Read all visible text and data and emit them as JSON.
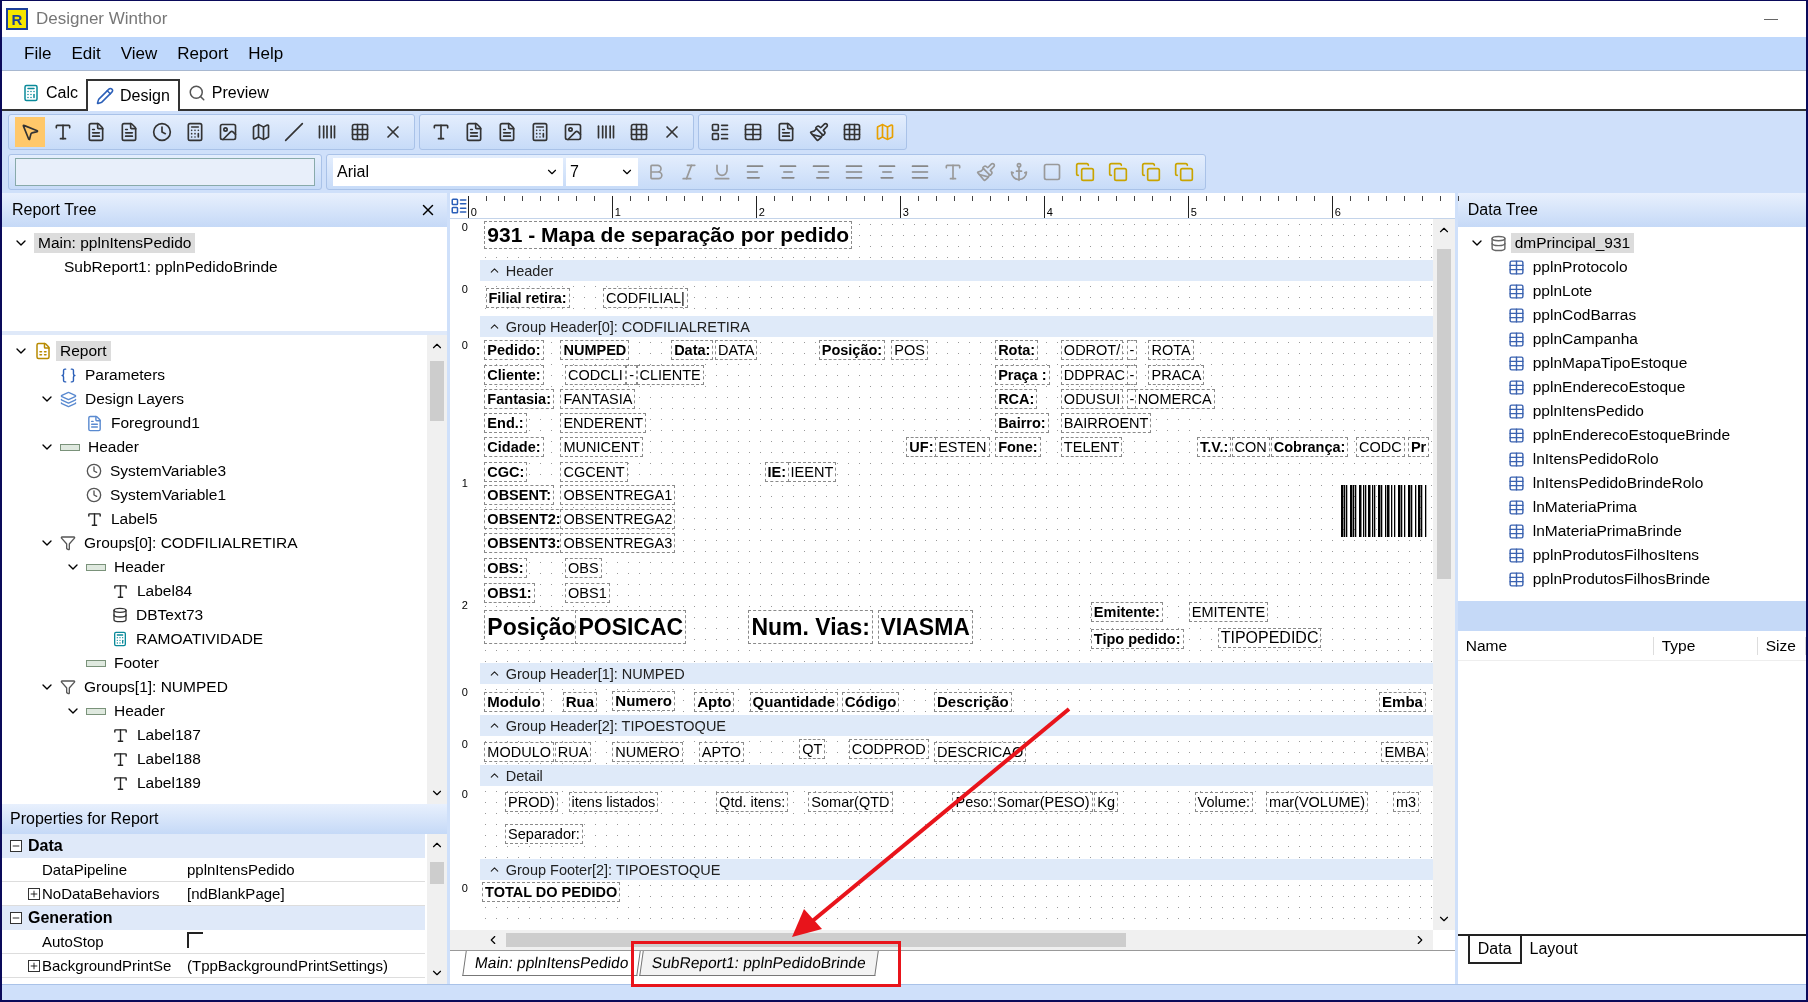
{
  "window": {
    "app_icon": "R",
    "title": "Designer Winthor"
  },
  "menu": [
    "File",
    "Edit",
    "View",
    "Report",
    "Help"
  ],
  "mode_tabs": [
    {
      "label": "Calc",
      "selected": false
    },
    {
      "label": "Design",
      "selected": true
    },
    {
      "label": "Preview",
      "selected": false
    }
  ],
  "format_bar": {
    "font": "Arial",
    "size": "7"
  },
  "report_tree": {
    "title": "Report Tree",
    "reports": [
      {
        "label": "Main: pplnItensPedido",
        "selected": true,
        "expanded": true,
        "children": [
          {
            "label": "SubReport1: pplnPedidoBrinde",
            "selected": false
          }
        ]
      }
    ],
    "components": [
      {
        "label": "Report",
        "kind": "report",
        "selected": true,
        "expanded": true,
        "children": [
          {
            "label": "Parameters",
            "kind": "parameters",
            "selected": false
          },
          {
            "label": "Design Layers",
            "kind": "layers",
            "selected": false,
            "expanded": true,
            "children": [
              {
                "label": "Foreground1",
                "kind": "page",
                "selected": false
              }
            ]
          },
          {
            "label": "Header",
            "kind": "band",
            "selected": false,
            "expanded": true,
            "children": [
              {
                "label": "SystemVariable3",
                "kind": "sysvar",
                "selected": false
              },
              {
                "label": "SystemVariable1",
                "kind": "sysvar",
                "selected": false
              },
              {
                "label": "Label5",
                "kind": "label",
                "selected": false
              }
            ]
          },
          {
            "label": "Groups[0]: CODFILIALRETIRA",
            "kind": "group",
            "selected": false,
            "expanded": true,
            "children": [
              {
                "label": "Header",
                "kind": "band",
                "selected": false,
                "expanded": true,
                "children": [
                  {
                    "label": "Label84",
                    "kind": "label",
                    "selected": false
                  },
                  {
                    "label": "DBText73",
                    "kind": "dbtext",
                    "selected": false
                  },
                  {
                    "label": "RAMOATIVIDADE",
                    "kind": "calc",
                    "selected": false
                  }
                ]
              },
              {
                "label": "Footer",
                "kind": "band",
                "selected": false
              }
            ]
          },
          {
            "label": "Groups[1]: NUMPED",
            "kind": "group",
            "selected": false,
            "expanded": true,
            "children": [
              {
                "label": "Header",
                "kind": "band",
                "selected": false,
                "expanded": true,
                "children": [
                  {
                    "label": "Label187",
                    "kind": "label",
                    "selected": false
                  },
                  {
                    "label": "Label188",
                    "kind": "label",
                    "selected": false
                  },
                  {
                    "label": "Label189",
                    "kind": "label",
                    "selected": false
                  }
                ]
              }
            ]
          }
        ]
      }
    ]
  },
  "properties": {
    "title": "Properties for Report",
    "categories": [
      {
        "name": "Data",
        "expanded": true,
        "rows": [
          {
            "kind": "text",
            "name": "DataPipeline",
            "value": "pplnItensPedido"
          },
          {
            "kind": "text",
            "name": "NoDataBehaviors",
            "value": "[ndBlankPage]",
            "expanded": false
          }
        ]
      },
      {
        "name": "Generation",
        "expanded": true,
        "rows": [
          {
            "kind": "checkbox",
            "name": "AutoStop",
            "checked": false
          },
          {
            "kind": "text",
            "name": "BackgroundPrintSe",
            "value": "(TppBackgroundPrintSettings)",
            "expanded": false
          }
        ]
      }
    ]
  },
  "ruler": [
    "0",
    "1",
    "2",
    "3",
    "4",
    "5",
    "6"
  ],
  "bands": [
    {
      "ruler": [
        "0"
      ],
      "items": [
        {
          "kind": "title",
          "text": "931 - Mapa de separação por pedido"
        }
      ]
    },
    {
      "title": "Header",
      "ruler": [
        "0"
      ],
      "items": [
        {
          "kind": "label",
          "text": "Filial retira:"
        },
        {
          "kind": "field",
          "text": "CODFILIAL|"
        }
      ]
    },
    {
      "title": "Group Header[0]: CODFILIALRETIRA",
      "ruler": [
        "0",
        "1",
        "2"
      ],
      "items": [
        {
          "kind": "label",
          "text": "Pedido:"
        },
        {
          "kind": "label",
          "text": "NUMPED"
        },
        {
          "kind": "label",
          "text": "Data:"
        },
        {
          "kind": "field",
          "text": "DATA"
        },
        {
          "kind": "label",
          "text": "Posição:"
        },
        {
          "kind": "field",
          "text": "POS"
        },
        {
          "kind": "label",
          "text": "Rota:"
        },
        {
          "kind": "field",
          "text": "ODROT/"
        },
        {
          "kind": "field",
          "text": "-"
        },
        {
          "kind": "field",
          "text": "ROTA"
        },
        {
          "kind": "label",
          "text": "Cliente:"
        },
        {
          "kind": "field",
          "text": "CODCLI"
        },
        {
          "kind": "field",
          "text": "-"
        },
        {
          "kind": "field",
          "text": "CLIENTE"
        },
        {
          "kind": "label",
          "text": "Praça :"
        },
        {
          "kind": "field",
          "text": "DDPRAC"
        },
        {
          "kind": "field",
          "text": "-"
        },
        {
          "kind": "field",
          "text": "PRACA"
        },
        {
          "kind": "label",
          "text": "Fantasia:"
        },
        {
          "kind": "field",
          "text": "FANTASIA"
        },
        {
          "kind": "label",
          "text": "RCA:"
        },
        {
          "kind": "field",
          "text": "ODUSUI"
        },
        {
          "kind": "field",
          "text": "-"
        },
        {
          "kind": "field",
          "text": "NOMERCA"
        },
        {
          "kind": "label",
          "text": "End.:"
        },
        {
          "kind": "field",
          "text": "ENDERENT"
        },
        {
          "kind": "label",
          "text": "Bairro:"
        },
        {
          "kind": "field",
          "text": "BAIRROENT"
        },
        {
          "kind": "label",
          "text": "Cidade:"
        },
        {
          "kind": "field",
          "text": "MUNICENT"
        },
        {
          "kind": "label",
          "text": "UF:"
        },
        {
          "kind": "field",
          "text": "ESTEN"
        },
        {
          "kind": "label",
          "text": "Fone:"
        },
        {
          "kind": "field",
          "text": "TELENT"
        },
        {
          "kind": "label",
          "text": "T.V.:"
        },
        {
          "kind": "field",
          "text": "CON"
        },
        {
          "kind": "label",
          "text": "Cobrança:"
        },
        {
          "kind": "field",
          "text": "CODC"
        },
        {
          "kind": "label",
          "text": "Pr"
        },
        {
          "kind": "label",
          "text": "CGC:"
        },
        {
          "kind": "field",
          "text": "CGCENT"
        },
        {
          "kind": "label",
          "text": "IE:"
        },
        {
          "kind": "field",
          "text": "IEENT"
        },
        {
          "kind": "label",
          "text": "OBSENT:"
        },
        {
          "kind": "field",
          "text": "OBSENTREGA1"
        },
        {
          "kind": "label",
          "text": "OBSENT2:"
        },
        {
          "kind": "field",
          "text": "OBSENTREGA2"
        },
        {
          "kind": "label",
          "text": "OBSENT3:"
        },
        {
          "kind": "field",
          "text": "OBSENTREGA3"
        },
        {
          "kind": "label",
          "text": "OBS:"
        },
        {
          "kind": "field",
          "text": "OBS"
        },
        {
          "kind": "label",
          "text": "OBS1:"
        },
        {
          "kind": "field",
          "text": "OBS1"
        },
        {
          "kind": "big-label",
          "text": "Posição"
        },
        {
          "kind": "big-label",
          "text": "POSICAC"
        },
        {
          "kind": "big-label",
          "text": "Num. Vias:"
        },
        {
          "kind": "big-label",
          "text": "VIASMA"
        },
        {
          "kind": "label",
          "text": "Emitente:"
        },
        {
          "kind": "field",
          "text": "EMITENTE"
        },
        {
          "kind": "label",
          "text": "Tipo pedido:"
        },
        {
          "kind": "mid-label",
          "text": "TIPOPEDIDC"
        },
        {
          "kind": "barcode"
        }
      ]
    },
    {
      "title": "Group Header[1]: NUMPED",
      "ruler": [
        "0"
      ],
      "items": [
        {
          "kind": "head",
          "text": "Modulo"
        },
        {
          "kind": "head",
          "text": "Rua"
        },
        {
          "kind": "head",
          "text": "Numero"
        },
        {
          "kind": "head",
          "text": "Apto"
        },
        {
          "kind": "head",
          "text": "Quantidade"
        },
        {
          "kind": "head",
          "text": "Código"
        },
        {
          "kind": "head",
          "text": "Descrição"
        },
        {
          "kind": "head",
          "text": "Emba"
        }
      ]
    },
    {
      "title": "Group Header[2]: TIPOESTOQUE",
      "ruler": [
        "0"
      ],
      "items": [
        {
          "kind": "mid-field",
          "text": "MODULO"
        },
        {
          "kind": "mid-field",
          "text": "RUA"
        },
        {
          "kind": "mid-field",
          "text": "NUMERO"
        },
        {
          "kind": "mid-field",
          "text": "APTO"
        },
        {
          "kind": "field",
          "text": "QT"
        },
        {
          "kind": "field",
          "text": "CODPROD"
        },
        {
          "kind": "field",
          "text": "DESCRICAO"
        },
        {
          "kind": "field",
          "text": "EMBA"
        }
      ]
    },
    {
      "title": "Detail",
      "ruler": [
        "0"
      ],
      "items": [
        {
          "kind": "mid-field",
          "text": "PROD)"
        },
        {
          "kind": "mid-field",
          "text": "itens listados"
        },
        {
          "kind": "mid-field",
          "text": "Qtd. itens:"
        },
        {
          "kind": "mid-field",
          "text": "Somar(QTD"
        },
        {
          "kind": "mid-field",
          "text": "Peso:"
        },
        {
          "kind": "mid-field",
          "text": "Somar(PESO)"
        },
        {
          "kind": "mid-field",
          "text": "Kg"
        },
        {
          "kind": "mid-field",
          "text": "Volume:"
        },
        {
          "kind": "mid-field",
          "text": "mar(VOLUME)"
        },
        {
          "kind": "mid-field",
          "text": "m3"
        },
        {
          "kind": "mid-field",
          "text": "Separador:"
        }
      ]
    },
    {
      "title": "Group Footer[2]: TIPOESTOQUE",
      "ruler": [
        "0"
      ],
      "items": [
        {
          "kind": "label",
          "text": "TOTAL DO PEDIDO"
        }
      ]
    }
  ],
  "report_tabs": [
    {
      "label": "Main: pplnItensPedido",
      "selected": true
    },
    {
      "label": "SubReport1: pplnPedidoBrinde",
      "selected": false
    }
  ],
  "data_tree": {
    "title": "Data Tree",
    "root": {
      "label": "dmPrincipal_931",
      "selected": true,
      "expanded": true,
      "children": [
        "pplnProtocolo",
        "pplnLote",
        "pplnCodBarras",
        "pplnCampanha",
        "pplnMapaTipoEstoque",
        "pplnEnderecoEstoque",
        "pplnItensPedido",
        "pplnEnderecoEstoqueBrinde",
        "lnItensPedidoRolo",
        "lnItensPedidoBrindeRolo",
        "lnMateriaPrima",
        "lnMateriaPrimaBrinde",
        "pplnProdutosFilhosItens",
        "pplnProdutosFilhosBrinde"
      ]
    },
    "columns": [
      "Name",
      "Type",
      "Size"
    ],
    "tabs": [
      {
        "label": "Data",
        "selected": true
      },
      {
        "label": "Layout",
        "selected": false
      }
    ]
  }
}
